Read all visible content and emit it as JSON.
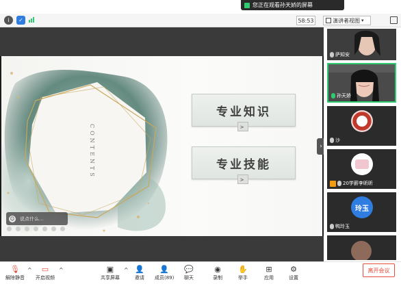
{
  "banner": {
    "text": "您正在观看孙天娇的屏幕",
    "icon": "screen-share-icon"
  },
  "topbar": {
    "timer": "58:53",
    "view_label": "演讲者视图"
  },
  "slide": {
    "vertical_word": "CONTENTS",
    "items": [
      "专业知识",
      "专业技能"
    ]
  },
  "chat_input": {
    "placeholder": "说点什么..."
  },
  "participants": [
    {
      "name": "萨知安",
      "type": "video"
    },
    {
      "name": "孙天娇",
      "type": "video",
      "speaking": true
    },
    {
      "name": "沙",
      "type": "avatar"
    },
    {
      "name": "20学薪李昕昕",
      "type": "avatar"
    },
    {
      "name": "鸭玲玉",
      "avatar_text": "玲玉",
      "type": "avatar"
    }
  ],
  "bottom": {
    "mute": "解除静音",
    "video": "开启视频",
    "share": "共享屏幕",
    "invite": "邀请",
    "members": "成员(89)",
    "chat": "聊天",
    "record": "录制",
    "raise": "举手",
    "apps": "应用",
    "settings": "设置",
    "leave": "离开会议"
  }
}
